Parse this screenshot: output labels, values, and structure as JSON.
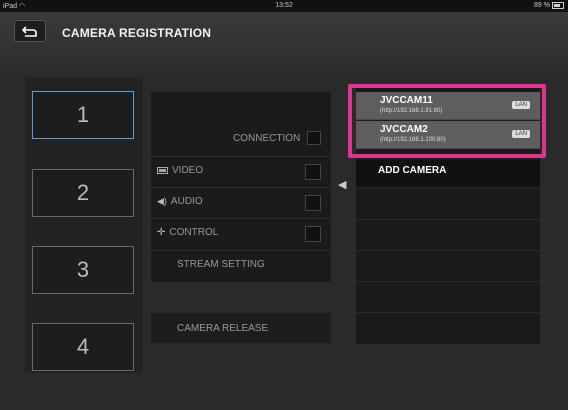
{
  "status_bar": {
    "device": "iPad",
    "time": "13:52",
    "battery": "89 %"
  },
  "header": {
    "title": "CAMERA REGISTRATION"
  },
  "slots": [
    "1",
    "2",
    "3",
    "4"
  ],
  "middle": {
    "connection_label": "CONNECTION",
    "video_label": "VIDEO",
    "audio_label": "AUDIO",
    "control_label": "CONTROL",
    "stream_setting_label": "STREAM SETTING",
    "camera_release_label": "CAMERA RELEASE"
  },
  "cameras": [
    {
      "name": "JVCCAM11",
      "url": "(http://192.168.1.91:80)",
      "badge": "LAN"
    },
    {
      "name": "JVCCAM2",
      "url": "(http://192.168.1.100:80)",
      "badge": "LAN"
    }
  ],
  "add_camera_label": "ADD CAMERA",
  "colors": {
    "highlight": "#e0358f",
    "selected_border": "#5aa0d8"
  }
}
